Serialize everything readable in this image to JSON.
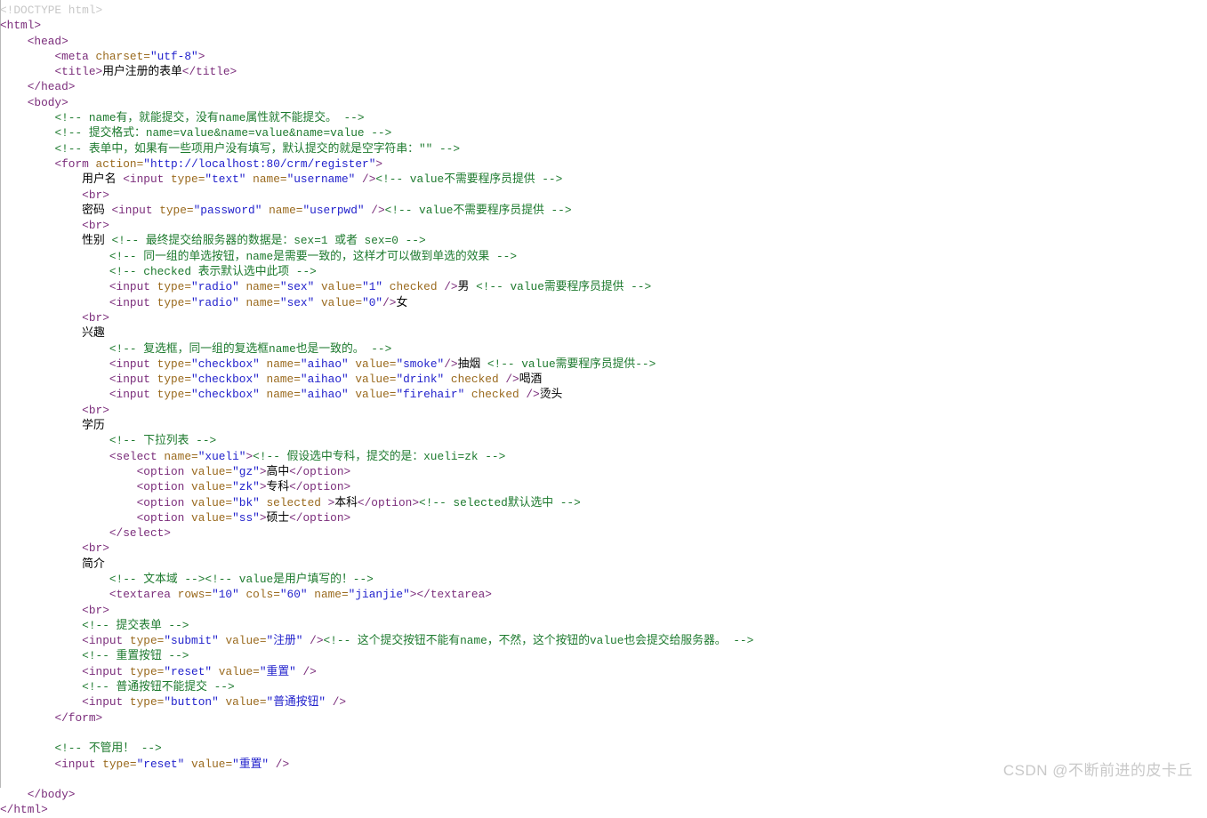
{
  "page": {
    "kind": "source-code-listing",
    "language": "html",
    "background_color": "#ffffff",
    "gutter_color": "#b8b8b8"
  },
  "theme": {
    "doctype_color": "#c8c8c8",
    "tag_color": "#7b2d7b",
    "attribute_color": "#9a6a1e",
    "value_color": "#2222cc",
    "comment_color": "#1d7a2e",
    "text_color": "#000000"
  },
  "watermark": {
    "text": "CSDN @不断前进的皮卡丘"
  },
  "code": {
    "lines": [
      [
        {
          "t": "doctype",
          "s": "<!DOCTYPE html>"
        }
      ],
      [
        {
          "t": "tag",
          "s": "<html>"
        }
      ],
      [
        {
          "t": "plain",
          "s": "    "
        },
        {
          "t": "tag",
          "s": "<head>"
        }
      ],
      [
        {
          "t": "plain",
          "s": "        "
        },
        {
          "t": "tag",
          "s": "<meta "
        },
        {
          "t": "attr",
          "s": "charset="
        },
        {
          "t": "value",
          "s": "\"utf-8\""
        },
        {
          "t": "tag",
          "s": ">"
        }
      ],
      [
        {
          "t": "plain",
          "s": "        "
        },
        {
          "t": "tag",
          "s": "<title>"
        },
        {
          "t": "text",
          "s": "用户注册的表单"
        },
        {
          "t": "tag",
          "s": "</title>"
        }
      ],
      [
        {
          "t": "plain",
          "s": "    "
        },
        {
          "t": "tag",
          "s": "</head>"
        }
      ],
      [
        {
          "t": "plain",
          "s": "    "
        },
        {
          "t": "tag",
          "s": "<body>"
        }
      ],
      [
        {
          "t": "plain",
          "s": "        "
        },
        {
          "t": "comment",
          "s": "<!-- name有，就能提交，没有name属性就不能提交。 -->"
        }
      ],
      [
        {
          "t": "plain",
          "s": "        "
        },
        {
          "t": "comment",
          "s": "<!-- 提交格式：name=value&name=value&name=value -->"
        }
      ],
      [
        {
          "t": "plain",
          "s": "        "
        },
        {
          "t": "comment",
          "s": "<!-- 表单中，如果有一些项用户没有填写，默认提交的就是空字符串：\"\" -->"
        }
      ],
      [
        {
          "t": "plain",
          "s": "        "
        },
        {
          "t": "tag",
          "s": "<form "
        },
        {
          "t": "attr",
          "s": "action="
        },
        {
          "t": "value",
          "s": "\"http://localhost:80/crm/register\""
        },
        {
          "t": "tag",
          "s": ">"
        }
      ],
      [
        {
          "t": "plain",
          "s": "            "
        },
        {
          "t": "text",
          "s": "用户名 "
        },
        {
          "t": "tag",
          "s": "<input "
        },
        {
          "t": "attr",
          "s": "type="
        },
        {
          "t": "value",
          "s": "\"text\""
        },
        {
          "t": "attr",
          "s": " name="
        },
        {
          "t": "value",
          "s": "\"username\""
        },
        {
          "t": "tag",
          "s": " />"
        },
        {
          "t": "comment",
          "s": "<!-- value不需要程序员提供 -->"
        }
      ],
      [
        {
          "t": "plain",
          "s": "            "
        },
        {
          "t": "tag",
          "s": "<br>"
        }
      ],
      [
        {
          "t": "plain",
          "s": "            "
        },
        {
          "t": "text",
          "s": "密码 "
        },
        {
          "t": "tag",
          "s": "<input "
        },
        {
          "t": "attr",
          "s": "type="
        },
        {
          "t": "value",
          "s": "\"password\""
        },
        {
          "t": "attr",
          "s": " name="
        },
        {
          "t": "value",
          "s": "\"userpwd\""
        },
        {
          "t": "tag",
          "s": " />"
        },
        {
          "t": "comment",
          "s": "<!-- value不需要程序员提供 -->"
        }
      ],
      [
        {
          "t": "plain",
          "s": "            "
        },
        {
          "t": "tag",
          "s": "<br>"
        }
      ],
      [
        {
          "t": "plain",
          "s": "            "
        },
        {
          "t": "text",
          "s": "性别 "
        },
        {
          "t": "comment",
          "s": "<!-- 最终提交给服务器的数据是：sex=1 或者 sex=0 -->"
        }
      ],
      [
        {
          "t": "plain",
          "s": "                "
        },
        {
          "t": "comment",
          "s": "<!-- 同一组的单选按钮，name是需要一致的，这样才可以做到单选的效果 -->"
        }
      ],
      [
        {
          "t": "plain",
          "s": "                "
        },
        {
          "t": "comment",
          "s": "<!-- checked 表示默认选中此项 -->"
        }
      ],
      [
        {
          "t": "plain",
          "s": "                "
        },
        {
          "t": "tag",
          "s": "<input "
        },
        {
          "t": "attr",
          "s": "type="
        },
        {
          "t": "value",
          "s": "\"radio\""
        },
        {
          "t": "attr",
          "s": " name="
        },
        {
          "t": "value",
          "s": "\"sex\""
        },
        {
          "t": "attr",
          "s": " value="
        },
        {
          "t": "value",
          "s": "\"1\""
        },
        {
          "t": "attr",
          "s": " checked"
        },
        {
          "t": "tag",
          "s": " />"
        },
        {
          "t": "text",
          "s": "男 "
        },
        {
          "t": "comment",
          "s": "<!-- value需要程序员提供 -->"
        }
      ],
      [
        {
          "t": "plain",
          "s": "                "
        },
        {
          "t": "tag",
          "s": "<input "
        },
        {
          "t": "attr",
          "s": "type="
        },
        {
          "t": "value",
          "s": "\"radio\""
        },
        {
          "t": "attr",
          "s": " name="
        },
        {
          "t": "value",
          "s": "\"sex\""
        },
        {
          "t": "attr",
          "s": " value="
        },
        {
          "t": "value",
          "s": "\"0\""
        },
        {
          "t": "tag",
          "s": "/>"
        },
        {
          "t": "text",
          "s": "女"
        }
      ],
      [
        {
          "t": "plain",
          "s": "            "
        },
        {
          "t": "tag",
          "s": "<br>"
        }
      ],
      [
        {
          "t": "plain",
          "s": "            "
        },
        {
          "t": "text",
          "s": "兴趣"
        }
      ],
      [
        {
          "t": "plain",
          "s": "                "
        },
        {
          "t": "comment",
          "s": "<!-- 复选框，同一组的复选框name也是一致的。 -->"
        }
      ],
      [
        {
          "t": "plain",
          "s": "                "
        },
        {
          "t": "tag",
          "s": "<input "
        },
        {
          "t": "attr",
          "s": "type="
        },
        {
          "t": "value",
          "s": "\"checkbox\""
        },
        {
          "t": "attr",
          "s": " name="
        },
        {
          "t": "value",
          "s": "\"aihao\""
        },
        {
          "t": "attr",
          "s": " value="
        },
        {
          "t": "value",
          "s": "\"smoke\""
        },
        {
          "t": "tag",
          "s": "/>"
        },
        {
          "t": "text",
          "s": "抽烟 "
        },
        {
          "t": "comment",
          "s": "<!-- value需要程序员提供-->"
        }
      ],
      [
        {
          "t": "plain",
          "s": "                "
        },
        {
          "t": "tag",
          "s": "<input "
        },
        {
          "t": "attr",
          "s": "type="
        },
        {
          "t": "value",
          "s": "\"checkbox\""
        },
        {
          "t": "attr",
          "s": " name="
        },
        {
          "t": "value",
          "s": "\"aihao\""
        },
        {
          "t": "attr",
          "s": " value="
        },
        {
          "t": "value",
          "s": "\"drink\""
        },
        {
          "t": "attr",
          "s": " checked"
        },
        {
          "t": "tag",
          "s": " />"
        },
        {
          "t": "text",
          "s": "喝酒"
        }
      ],
      [
        {
          "t": "plain",
          "s": "                "
        },
        {
          "t": "tag",
          "s": "<input "
        },
        {
          "t": "attr",
          "s": "type="
        },
        {
          "t": "value",
          "s": "\"checkbox\""
        },
        {
          "t": "attr",
          "s": " name="
        },
        {
          "t": "value",
          "s": "\"aihao\""
        },
        {
          "t": "attr",
          "s": " value="
        },
        {
          "t": "value",
          "s": "\"firehair\""
        },
        {
          "t": "attr",
          "s": " checked"
        },
        {
          "t": "tag",
          "s": " />"
        },
        {
          "t": "text",
          "s": "烫头"
        }
      ],
      [
        {
          "t": "plain",
          "s": "            "
        },
        {
          "t": "tag",
          "s": "<br>"
        }
      ],
      [
        {
          "t": "plain",
          "s": "            "
        },
        {
          "t": "text",
          "s": "学历"
        }
      ],
      [
        {
          "t": "plain",
          "s": "                "
        },
        {
          "t": "comment",
          "s": "<!-- 下拉列表 -->"
        }
      ],
      [
        {
          "t": "plain",
          "s": "                "
        },
        {
          "t": "tag",
          "s": "<select "
        },
        {
          "t": "attr",
          "s": "name="
        },
        {
          "t": "value",
          "s": "\"xueli\""
        },
        {
          "t": "tag",
          "s": ">"
        },
        {
          "t": "comment",
          "s": "<!-- 假设选中专科，提交的是：xueli=zk -->"
        }
      ],
      [
        {
          "t": "plain",
          "s": "                    "
        },
        {
          "t": "tag",
          "s": "<option "
        },
        {
          "t": "attr",
          "s": "value="
        },
        {
          "t": "value",
          "s": "\"gz\""
        },
        {
          "t": "tag",
          "s": ">"
        },
        {
          "t": "text",
          "s": "高中"
        },
        {
          "t": "tag",
          "s": "</option>"
        }
      ],
      [
        {
          "t": "plain",
          "s": "                    "
        },
        {
          "t": "tag",
          "s": "<option "
        },
        {
          "t": "attr",
          "s": "value="
        },
        {
          "t": "value",
          "s": "\"zk\""
        },
        {
          "t": "tag",
          "s": ">"
        },
        {
          "t": "text",
          "s": "专科"
        },
        {
          "t": "tag",
          "s": "</option>"
        }
      ],
      [
        {
          "t": "plain",
          "s": "                    "
        },
        {
          "t": "tag",
          "s": "<option "
        },
        {
          "t": "attr",
          "s": "value="
        },
        {
          "t": "value",
          "s": "\"bk\""
        },
        {
          "t": "attr",
          "s": " selected "
        },
        {
          "t": "tag",
          "s": ">"
        },
        {
          "t": "text",
          "s": "本科"
        },
        {
          "t": "tag",
          "s": "</option>"
        },
        {
          "t": "comment",
          "s": "<!-- selected默认选中 -->"
        }
      ],
      [
        {
          "t": "plain",
          "s": "                    "
        },
        {
          "t": "tag",
          "s": "<option "
        },
        {
          "t": "attr",
          "s": "value="
        },
        {
          "t": "value",
          "s": "\"ss\""
        },
        {
          "t": "tag",
          "s": ">"
        },
        {
          "t": "text",
          "s": "硕士"
        },
        {
          "t": "tag",
          "s": "</option>"
        }
      ],
      [
        {
          "t": "plain",
          "s": "                "
        },
        {
          "t": "tag",
          "s": "</select>"
        }
      ],
      [
        {
          "t": "plain",
          "s": "            "
        },
        {
          "t": "tag",
          "s": "<br>"
        }
      ],
      [
        {
          "t": "plain",
          "s": "            "
        },
        {
          "t": "text",
          "s": "简介"
        }
      ],
      [
        {
          "t": "plain",
          "s": "                "
        },
        {
          "t": "comment",
          "s": "<!-- 文本域 -->"
        },
        {
          "t": "comment",
          "s": "<!-- value是用户填写的！-->"
        }
      ],
      [
        {
          "t": "plain",
          "s": "                "
        },
        {
          "t": "tag",
          "s": "<textarea "
        },
        {
          "t": "attr",
          "s": "rows="
        },
        {
          "t": "value",
          "s": "\"10\""
        },
        {
          "t": "attr",
          "s": " cols="
        },
        {
          "t": "value",
          "s": "\"60\""
        },
        {
          "t": "attr",
          "s": " name="
        },
        {
          "t": "value",
          "s": "\"jianjie\""
        },
        {
          "t": "tag",
          "s": "></textarea>"
        }
      ],
      [
        {
          "t": "plain",
          "s": "            "
        },
        {
          "t": "tag",
          "s": "<br>"
        }
      ],
      [
        {
          "t": "plain",
          "s": "            "
        },
        {
          "t": "comment",
          "s": "<!-- 提交表单 -->"
        }
      ],
      [
        {
          "t": "plain",
          "s": "            "
        },
        {
          "t": "tag",
          "s": "<input "
        },
        {
          "t": "attr",
          "s": "type="
        },
        {
          "t": "value",
          "s": "\"submit\""
        },
        {
          "t": "attr",
          "s": " value="
        },
        {
          "t": "value",
          "s": "\"注册\""
        },
        {
          "t": "tag",
          "s": " />"
        },
        {
          "t": "comment",
          "s": "<!-- 这个提交按钮不能有name，不然，这个按钮的value也会提交给服务器。 -->"
        }
      ],
      [
        {
          "t": "plain",
          "s": "            "
        },
        {
          "t": "comment",
          "s": "<!-- 重置按钮 -->"
        }
      ],
      [
        {
          "t": "plain",
          "s": "            "
        },
        {
          "t": "tag",
          "s": "<input "
        },
        {
          "t": "attr",
          "s": "type="
        },
        {
          "t": "value",
          "s": "\"reset\""
        },
        {
          "t": "attr",
          "s": " value="
        },
        {
          "t": "value",
          "s": "\"重置\""
        },
        {
          "t": "tag",
          "s": " />"
        }
      ],
      [
        {
          "t": "plain",
          "s": "            "
        },
        {
          "t": "comment",
          "s": "<!-- 普通按钮不能提交 -->"
        }
      ],
      [
        {
          "t": "plain",
          "s": "            "
        },
        {
          "t": "tag",
          "s": "<input "
        },
        {
          "t": "attr",
          "s": "type="
        },
        {
          "t": "value",
          "s": "\"button\""
        },
        {
          "t": "attr",
          "s": " value="
        },
        {
          "t": "value",
          "s": "\"普通按钮\""
        },
        {
          "t": "tag",
          "s": " />"
        }
      ],
      [
        {
          "t": "plain",
          "s": "        "
        },
        {
          "t": "tag",
          "s": "</form>"
        }
      ],
      [
        {
          "t": "plain",
          "s": ""
        }
      ],
      [
        {
          "t": "plain",
          "s": "        "
        },
        {
          "t": "comment",
          "s": "<!-- 不管用！ -->"
        }
      ],
      [
        {
          "t": "plain",
          "s": "        "
        },
        {
          "t": "tag",
          "s": "<input "
        },
        {
          "t": "attr",
          "s": "type="
        },
        {
          "t": "value",
          "s": "\"reset\""
        },
        {
          "t": "attr",
          "s": " value="
        },
        {
          "t": "value",
          "s": "\"重置\""
        },
        {
          "t": "tag",
          "s": " />"
        }
      ],
      [
        {
          "t": "plain",
          "s": ""
        }
      ],
      [
        {
          "t": "plain",
          "s": "    "
        },
        {
          "t": "tag",
          "s": "</body>"
        }
      ],
      [
        {
          "t": "tag",
          "s": "</html>"
        }
      ]
    ]
  }
}
